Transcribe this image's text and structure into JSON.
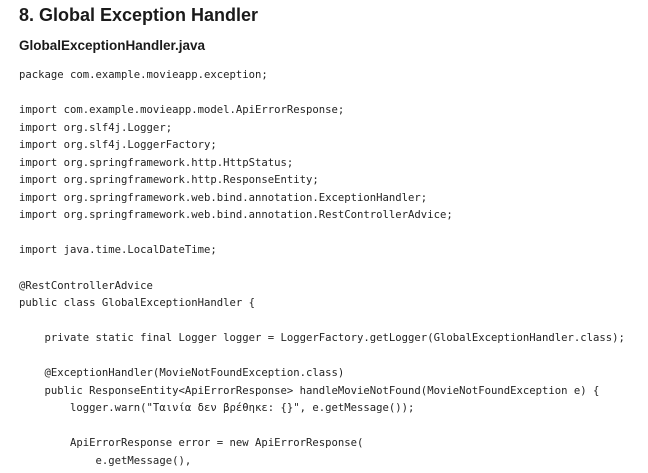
{
  "heading": "8. Global Exception Handler",
  "file_name": "GlobalExceptionHandler.java",
  "code_lines": [
    "package com.example.movieapp.exception;",
    "",
    "import com.example.movieapp.model.ApiErrorResponse;",
    "import org.slf4j.Logger;",
    "import org.slf4j.LoggerFactory;",
    "import org.springframework.http.HttpStatus;",
    "import org.springframework.http.ResponseEntity;",
    "import org.springframework.web.bind.annotation.ExceptionHandler;",
    "import org.springframework.web.bind.annotation.RestControllerAdvice;",
    "",
    "import java.time.LocalDateTime;",
    "",
    "@RestControllerAdvice",
    "public class GlobalExceptionHandler {",
    "",
    "    private static final Logger logger = LoggerFactory.getLogger(GlobalExceptionHandler.class);",
    "",
    "    @ExceptionHandler(MovieNotFoundException.class)",
    "    public ResponseEntity<ApiErrorResponse> handleMovieNotFound(MovieNotFoundException e) {",
    "        logger.warn(\"Ταινία δεν βρέθηκε: {}\", e.getMessage());",
    "",
    "        ApiErrorResponse error = new ApiErrorResponse(",
    "            e.getMessage(),"
  ]
}
